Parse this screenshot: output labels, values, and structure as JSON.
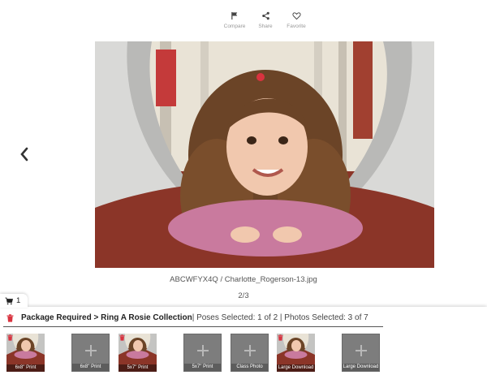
{
  "toolbar": {
    "compare": "Compare",
    "share": "Share",
    "favorite": "Favorite"
  },
  "photo": {
    "filename": "ABCWFYX4Q / Charlotte_Rogerson-13.jpg",
    "counter": "2/3"
  },
  "cart": {
    "count": "1",
    "package_title": "Package Required > Ring A Rosie Collection",
    "package_status": " | Poses Selected: 1 of 2 | Photos Selected: 3 of 7"
  },
  "thumbnails": [
    {
      "label": "6x8\" Print",
      "filled": true
    },
    {
      "label": "6x8\" Print",
      "filled": false
    },
    {
      "label": "5x7\" Print",
      "filled": true
    },
    {
      "label": "5x7\" Print",
      "filled": false
    },
    {
      "label": "Class Photo",
      "filled": false
    },
    {
      "label": "Large Download",
      "filled": true
    },
    {
      "label": "Large Download",
      "filled": false
    }
  ],
  "colors": {
    "accent_red": "#d9333f",
    "slide_red": "#8b3528"
  }
}
